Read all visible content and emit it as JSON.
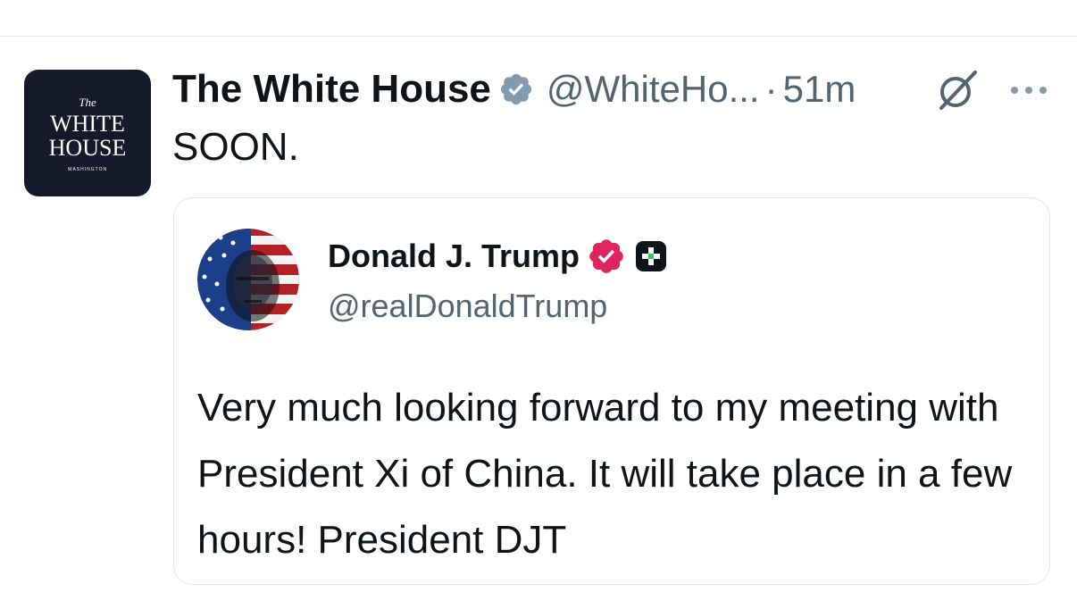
{
  "tweet": {
    "display_name": "The White House",
    "handle": "@WhiteHo...",
    "separator": "·",
    "timestamp": "51m",
    "text": "SOON.",
    "avatar": {
      "small_text": "The",
      "line1": "WHITE",
      "line2": "HOUSE",
      "location": "WASHINGTON",
      "background": "#141a2a"
    },
    "icons": {
      "verified": "verified-badge-gray",
      "grok": "grok-slash-icon",
      "more": "more-dots-icon"
    }
  },
  "quote": {
    "display_name": "Donald J. Trump",
    "handle": "@realDonaldTrump",
    "text": "Very much looking forward to my meeting with President Xi of China. It will take place in a few hours! President DJT",
    "icons": {
      "verified": "verified-badge-red",
      "plus": "plus-badge-icon"
    }
  },
  "colors": {
    "text_primary": "#0f1419",
    "text_secondary": "#536471",
    "verified_gray": "#829aab",
    "verified_red": "#e0245e",
    "border": "#e1e5e8"
  }
}
